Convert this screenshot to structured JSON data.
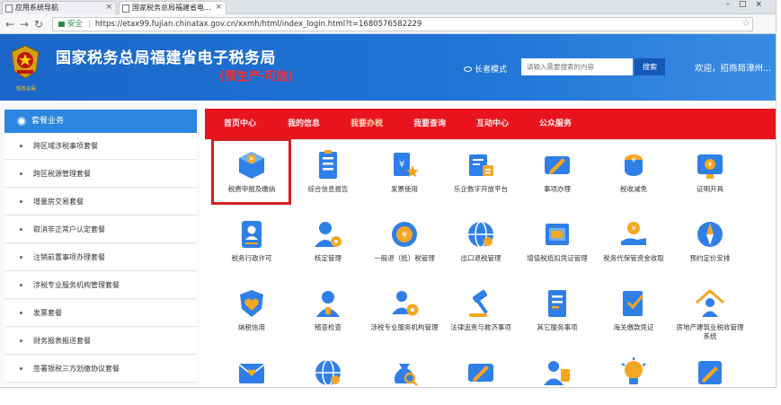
{
  "browser": {
    "tabs": [
      {
        "label": "应用系统导航"
      },
      {
        "label": "国家税务总局福建省电..."
      }
    ],
    "address": {
      "secure_label": "安全",
      "url": "https://etax99.fujian.chinatax.gov.cn/xxmh/html/index_login.html?t=1680576582229"
    }
  },
  "header": {
    "emblem_text": "税务总局",
    "title": "国家税务总局福建省电子税务局",
    "subtitle": "(预生产-可信)",
    "elder_mode": "长者模式",
    "search_placeholder": "请输入需要搜索的内容",
    "search_button": "搜索",
    "welcome": "欢迎，招商局漳州..."
  },
  "sidebar": {
    "title": "套餐业务",
    "items": [
      {
        "label": "跨区域涉税事项套餐"
      },
      {
        "label": "跨区税源管理套餐"
      },
      {
        "label": "增量房交易套餐"
      },
      {
        "label": "取消非正常户认定套餐"
      },
      {
        "label": "注销前置事项办理套餐"
      },
      {
        "label": "涉税专业服务机构管理套餐"
      },
      {
        "label": "发票套餐"
      },
      {
        "label": "财务报表报送套餐"
      },
      {
        "label": "签署银税三方划缴协议套餐"
      }
    ]
  },
  "menu": {
    "tabs": [
      {
        "label": "首页中心"
      },
      {
        "label": "我的信息"
      },
      {
        "label": "我要办税"
      },
      {
        "label": "我要查询"
      },
      {
        "label": "互动中心"
      },
      {
        "label": "公众服务"
      }
    ]
  },
  "grid": {
    "rows": [
      [
        {
          "label": "税费申报及缴纳",
          "icon": "box-icon"
        },
        {
          "label": "综合信息报告",
          "icon": "document-icon"
        },
        {
          "label": "发票使用",
          "icon": "invoice-star-icon"
        },
        {
          "label": "乐企数字开放平台",
          "icon": "platform-icon"
        },
        {
          "label": "事项办理",
          "icon": "ticket-pen-icon"
        },
        {
          "label": "税收减免",
          "icon": "coin-stack-icon"
        },
        {
          "label": "证明开具",
          "icon": "certificate-icon"
        }
      ],
      [
        {
          "label": "税务行政许可",
          "icon": "id-card-icon"
        },
        {
          "label": "核定管理",
          "icon": "user-gear-icon"
        },
        {
          "label": "一般退（抵）税管理",
          "icon": "refund-icon"
        },
        {
          "label": "出口退税管理",
          "icon": "globe-icon"
        },
        {
          "label": "增值税抵扣凭证管理",
          "icon": "film-receipt-icon"
        },
        {
          "label": "税务代保管资金收取",
          "icon": "money-hand-icon"
        },
        {
          "label": "预约定价安排",
          "icon": "compass-icon"
        }
      ],
      [
        {
          "label": "纳税信用",
          "icon": "heart-shield-icon"
        },
        {
          "label": "稽查检查",
          "icon": "person-icon"
        },
        {
          "label": "涉税专业服务机构管理",
          "icon": "agent-gear-icon"
        },
        {
          "label": "法律追责与救济事项",
          "icon": "gavel-icon"
        },
        {
          "label": "其它服务事项",
          "icon": "list-icon"
        },
        {
          "label": "海关缴款凭证",
          "icon": "check-doc-icon"
        },
        {
          "label": "房地产建筑业税收管理系统",
          "icon": "house-person-icon"
        }
      ],
      [
        {
          "label": "",
          "icon": "mail-heart-icon"
        },
        {
          "label": "",
          "icon": "globe-icon"
        },
        {
          "label": "",
          "icon": "money-bag-search-icon"
        },
        {
          "label": "",
          "icon": "ticket-pen-icon"
        },
        {
          "label": "",
          "icon": "user-doc-icon"
        },
        {
          "label": "",
          "icon": "bulb-icon"
        },
        {
          "label": "",
          "icon": "pen-doc-icon"
        }
      ]
    ]
  },
  "colors": {
    "header_blue": "#1f74d6",
    "menu_red": "#e8131c",
    "icon_blue": "#2f7fe8",
    "icon_orange": "#f5a623",
    "highlight_red": "#d42020"
  }
}
